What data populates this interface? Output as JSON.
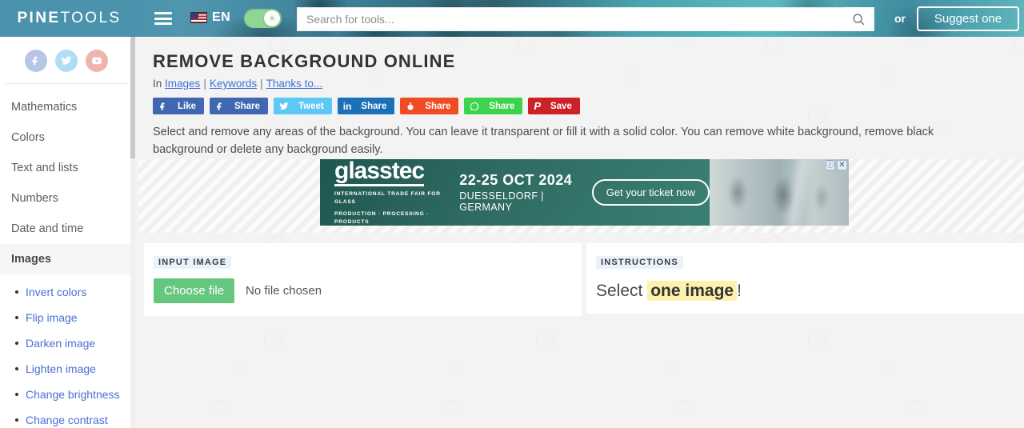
{
  "header": {
    "logo_pine": "PINE",
    "logo_tools": "TOOLS",
    "menu_icon": "hamburger-icon",
    "lang_code": "EN",
    "flag": "us-flag-icon",
    "theme_toggle": "on",
    "search_placeholder": "Search for tools...",
    "search_value": "",
    "search_icon": "search-icon",
    "or_label": "or",
    "suggest_label": "Suggest one"
  },
  "sidebar": {
    "social": [
      {
        "name": "facebook-icon",
        "label": "f"
      },
      {
        "name": "twitter-icon",
        "label": "t"
      },
      {
        "name": "youtube-icon",
        "label": "y"
      }
    ],
    "categories": [
      {
        "label": "Mathematics",
        "active": false
      },
      {
        "label": "Colors",
        "active": false
      },
      {
        "label": "Text and lists",
        "active": false
      },
      {
        "label": "Numbers",
        "active": false
      },
      {
        "label": "Date and time",
        "active": false
      },
      {
        "label": "Images",
        "active": true
      }
    ],
    "tools": [
      {
        "label": "Invert colors"
      },
      {
        "label": "Flip image"
      },
      {
        "label": "Darken image"
      },
      {
        "label": "Lighten image"
      },
      {
        "label": "Change brightness"
      },
      {
        "label": "Change contrast"
      }
    ]
  },
  "main": {
    "title": "REMOVE BACKGROUND ONLINE",
    "breadcrumb_prefix": "In",
    "breadcrumb_links": [
      "Images",
      "Keywords",
      "Thanks to..."
    ],
    "share_buttons": [
      {
        "label": "Like",
        "icon": "facebook-icon",
        "color": "#4267b2"
      },
      {
        "label": "Share",
        "icon": "facebook-icon",
        "color": "#4267b2"
      },
      {
        "label": "Tweet",
        "icon": "twitter-icon",
        "color": "#5dc8f5"
      },
      {
        "label": "Share",
        "icon": "linkedin-icon",
        "color": "#1a71b8"
      },
      {
        "label": "Share",
        "icon": "reddit-icon",
        "color": "#f04c23"
      },
      {
        "label": "Share",
        "icon": "whatsapp-icon",
        "color": "#3ed34e"
      },
      {
        "label": "Save",
        "icon": "pinterest-icon",
        "color": "#cc2127"
      }
    ],
    "description": "Select and remove any areas of the background. You can leave it transparent or fill it with a solid color. You can remove white background, remove black background or delete any background easily."
  },
  "ad": {
    "brand": "glasstec",
    "tagline_line1": "INTERNATIONAL TRADE FAIR FOR GLASS",
    "tagline_line2": "PRODUCTION · PROCESSING · PRODUCTS",
    "dates": "22-25 OCT 2024",
    "location": "DUESSELDORF | GERMANY",
    "cta": "Get your ticket now",
    "info_badge": "ⓘ",
    "close_badge": "✕"
  },
  "panels": {
    "input": {
      "label": "INPUT IMAGE",
      "choose_file": "Choose file",
      "file_status": "No file chosen"
    },
    "instructions": {
      "label": "INSTRUCTIONS",
      "text_before": "Select",
      "highlight": "one image",
      "text_after": "!"
    }
  },
  "colors": {
    "accent_green": "#65c77e",
    "link_blue": "#4a6fd4",
    "header_teal": "#4b93ad",
    "highlight_yellow": "#fdf1ae"
  }
}
